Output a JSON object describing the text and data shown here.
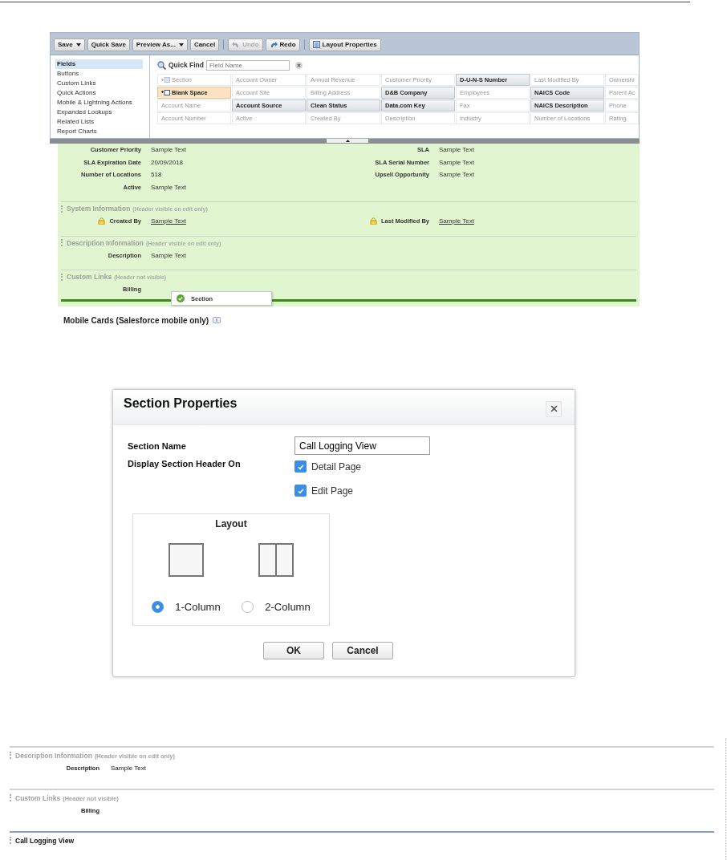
{
  "editor": {
    "toolbar": [
      [
        {
          "label": "Save",
          "dropdown": true,
          "disabled": false
        },
        {
          "label": "Quick Save",
          "dropdown": false,
          "disabled": false
        },
        {
          "label": "Preview As...",
          "dropdown": true,
          "disabled": false
        },
        {
          "label": "Cancel",
          "dropdown": false,
          "disabled": false
        }
      ],
      [
        {
          "label": "Undo",
          "dropdown": false,
          "disabled": true
        },
        {
          "label": "Redo",
          "dropdown": false,
          "disabled": false
        }
      ],
      [
        {
          "label": "Layout Properties",
          "dropdown": false,
          "disabled": false
        }
      ]
    ],
    "categories": [
      {
        "label": "Fields",
        "selected": true
      },
      {
        "label": "Buttons",
        "selected": false
      },
      {
        "label": "Custom Links",
        "selected": false
      },
      {
        "label": "Quick Actions",
        "selected": false
      },
      {
        "label": "Mobile & Lightning Actions",
        "selected": false
      },
      {
        "label": "Expanded Lookups",
        "selected": false
      },
      {
        "label": "Related Lists",
        "selected": false
      },
      {
        "label": "Report Charts",
        "selected": false
      }
    ],
    "quick_find": {
      "label": "Quick Find",
      "placeholder": "Field Name"
    },
    "palette": [
      {
        "label": "Section",
        "kind": "section",
        "on_layout": true,
        "selected": false
      },
      {
        "label": "Account Owner",
        "kind": "field",
        "on_layout": true,
        "selected": false
      },
      {
        "label": "Annual Revenue",
        "kind": "field",
        "on_layout": true,
        "selected": false
      },
      {
        "label": "Customer Priority",
        "kind": "field",
        "on_layout": true,
        "selected": false
      },
      {
        "label": "D-U-N-S Number",
        "kind": "field",
        "on_layout": false,
        "selected": false
      },
      {
        "label": "Last Modified By",
        "kind": "field",
        "on_layout": true,
        "selected": false
      },
      {
        "label": "Ownershi",
        "kind": "field",
        "on_layout": true,
        "selected": false
      },
      {
        "label": "Blank Space",
        "kind": "blank",
        "on_layout": false,
        "selected": true
      },
      {
        "label": "Account Site",
        "kind": "field",
        "on_layout": true,
        "selected": false
      },
      {
        "label": "Billing Address",
        "kind": "field",
        "on_layout": true,
        "selected": false
      },
      {
        "label": "D&B Company",
        "kind": "field",
        "on_layout": false,
        "selected": false
      },
      {
        "label": "Employees",
        "kind": "field",
        "on_layout": true,
        "selected": false
      },
      {
        "label": "NAICS Code",
        "kind": "field",
        "on_layout": false,
        "selected": false
      },
      {
        "label": "Parent Ac",
        "kind": "field",
        "on_layout": true,
        "selected": false
      },
      {
        "label": "Account Name",
        "kind": "field",
        "on_layout": true,
        "selected": false
      },
      {
        "label": "Account Source",
        "kind": "field",
        "on_layout": false,
        "selected": false
      },
      {
        "label": "Clean Status",
        "kind": "field",
        "on_layout": false,
        "selected": false
      },
      {
        "label": "Data.com Key",
        "kind": "field",
        "on_layout": false,
        "selected": false
      },
      {
        "label": "Fax",
        "kind": "field",
        "on_layout": true,
        "selected": false
      },
      {
        "label": "NAICS Description",
        "kind": "field",
        "on_layout": false,
        "selected": false
      },
      {
        "label": "Phone",
        "kind": "field",
        "on_layout": true,
        "selected": false
      },
      {
        "label": "Account Number",
        "kind": "field",
        "on_layout": true,
        "selected": false
      },
      {
        "label": "Active",
        "kind": "field",
        "on_layout": true,
        "selected": false
      },
      {
        "label": "Created By",
        "kind": "field",
        "on_layout": true,
        "selected": false
      },
      {
        "label": "Description",
        "kind": "field",
        "on_layout": true,
        "selected": false
      },
      {
        "label": "Industry",
        "kind": "field",
        "on_layout": true,
        "selected": false
      },
      {
        "label": "Number of Locations",
        "kind": "field",
        "on_layout": true,
        "selected": false
      },
      {
        "label": "Rating",
        "kind": "field",
        "on_layout": true,
        "selected": false
      }
    ],
    "sections": [
      {
        "rows": [
          [
            {
              "label": "Customer Priority",
              "value": "Sample Text",
              "link": false,
              "locked": false
            },
            {
              "label": "SLA",
              "value": "Sample Text",
              "link": false,
              "locked": false
            }
          ],
          [
            {
              "label": "SLA Expiration Date",
              "value": "20/09/2018",
              "link": false,
              "locked": false
            },
            {
              "label": "SLA Serial Number",
              "value": "Sample Text",
              "link": false,
              "locked": false
            }
          ],
          [
            {
              "label": "Number of Locations",
              "value": "518",
              "link": false,
              "locked": false
            },
            {
              "label": "Upsell Opportunity",
              "value": "Sample Text",
              "link": false,
              "locked": false
            }
          ],
          [
            {
              "label": "Active",
              "value": "Sample Text",
              "link": false,
              "locked": false
            }
          ]
        ]
      },
      {
        "title": "System Information",
        "note": "(Header visible on edit only)",
        "rows": [
          [
            {
              "label": "Created By",
              "value": "Sample Text",
              "link": true,
              "locked": true
            },
            {
              "label": "Last Modified By",
              "value": "Sample Text",
              "link": true,
              "locked": true
            }
          ]
        ]
      },
      {
        "title": "Description Information",
        "note": "(Header visible on edit only)",
        "rows": [
          [
            {
              "label": "Description",
              "value": "Sample Text",
              "link": false,
              "locked": false
            }
          ]
        ]
      },
      {
        "title": "Custom Links",
        "note": "(Header not visible)",
        "rows": [
          [
            {
              "label": "Billing",
              "locked": false
            }
          ]
        ]
      }
    ],
    "drag_tooltip": "Section",
    "mobile_heading": "Mobile Cards (Salesforce mobile only)"
  },
  "dialog": {
    "title": "Section Properties",
    "name_label": "Section Name",
    "name_value": "Call Logging View",
    "header_label": "Display Section Header On",
    "header_options": [
      {
        "label": "Detail Page",
        "checked": true
      },
      {
        "label": "Edit Page",
        "checked": true
      }
    ],
    "layout_title": "Layout",
    "layouts": [
      {
        "label": "1-Column",
        "selected": true
      },
      {
        "label": "2-Column",
        "selected": false
      }
    ],
    "buttons": [
      "OK",
      "Cancel"
    ]
  },
  "result": {
    "sections": [
      {
        "title": "Description Information",
        "note": "(Header visible on edit only)",
        "header_visible": false,
        "fields": [
          {
            "label": "Description",
            "value": "Sample Text"
          }
        ]
      },
      {
        "title": "Custom Links",
        "note": "(Header not visible)",
        "header_visible": false,
        "fields": [
          {
            "label": "Billing"
          }
        ]
      },
      {
        "title": "Call Logging View",
        "header_visible": true
      }
    ]
  }
}
